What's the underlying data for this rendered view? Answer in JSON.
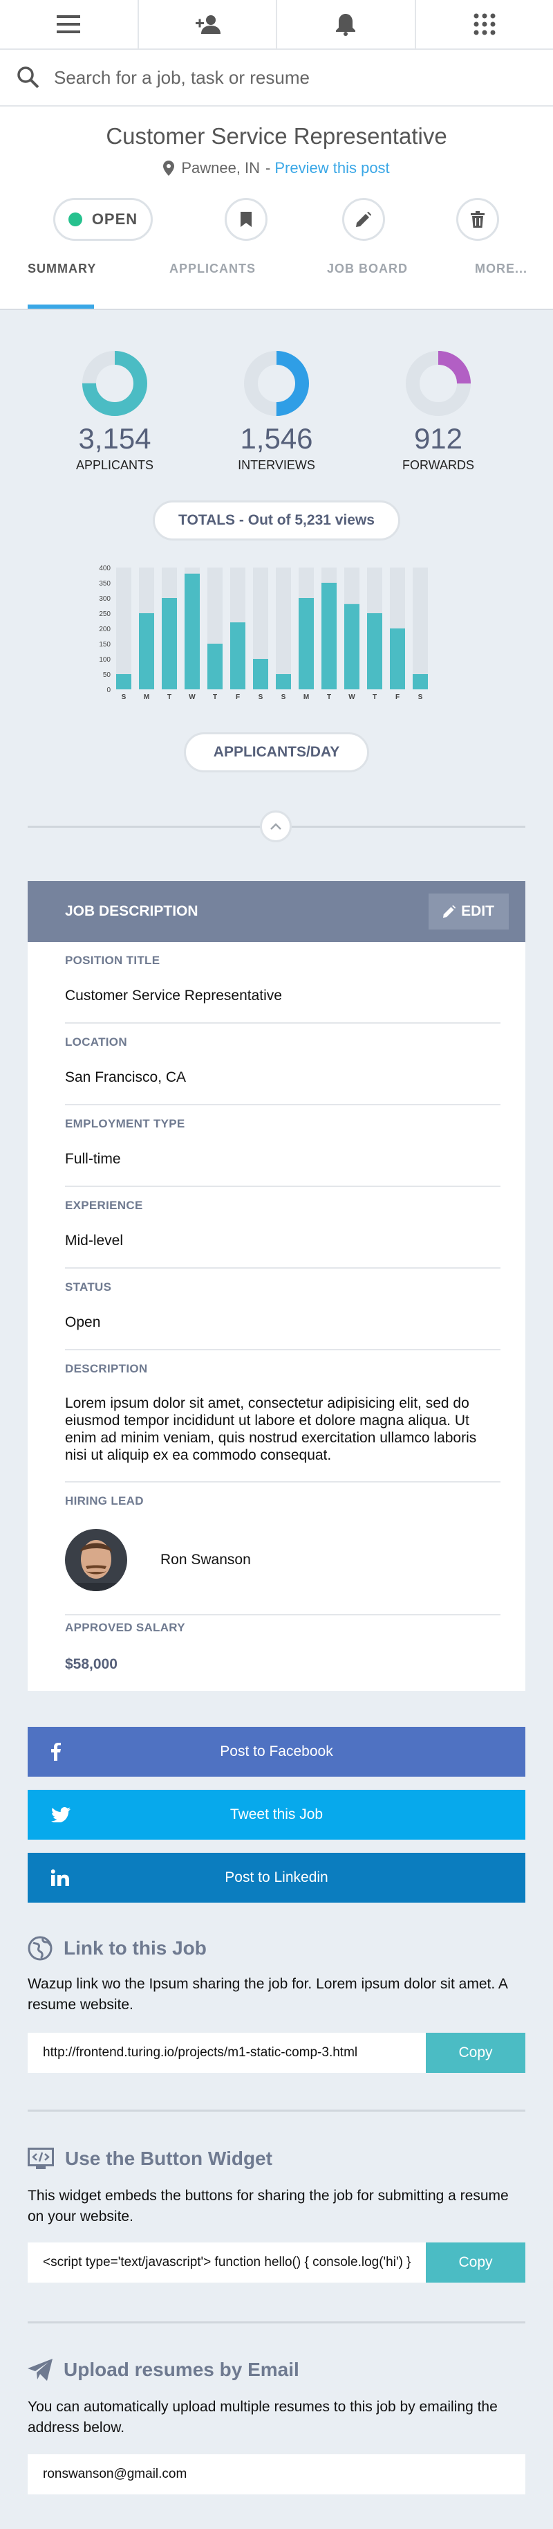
{
  "nav": {
    "icons": [
      "menu-icon",
      "add-user-icon",
      "bell-icon",
      "apps-grid-icon"
    ]
  },
  "search": {
    "placeholder": "Search for a job, task or resume"
  },
  "job": {
    "title": "Customer Service Representative",
    "location": "Pawnee, IN",
    "separator": "-",
    "preview_link": "Preview this post",
    "status_label": "OPEN",
    "status_color": "#26c18e"
  },
  "tabs": [
    "SUMMARY",
    "APPLICANTS",
    "JOB BOARD",
    "MORE..."
  ],
  "stats": [
    {
      "value": "3,154",
      "label": "APPLICANTS",
      "fraction": 0.75,
      "color": "#4bbcc4"
    },
    {
      "value": "1,546",
      "label": "INTERVIEWS",
      "fraction": 0.5,
      "color": "#2f9ee6"
    },
    {
      "value": "912",
      "label": "FORWARDS",
      "fraction": 0.25,
      "color": "#b25fc4"
    }
  ],
  "totals_label": "TOTALS - Out of 5,231 views",
  "applicants_day_label": "APPLICANTS/DAY",
  "chart_data": {
    "type": "bar",
    "categories": [
      "S",
      "M",
      "T",
      "W",
      "T",
      "F",
      "S",
      "S",
      "M",
      "T",
      "W",
      "T",
      "F",
      "S"
    ],
    "values": [
      50,
      250,
      300,
      380,
      150,
      220,
      100,
      50,
      300,
      350,
      280,
      250,
      200,
      50
    ],
    "max": 400,
    "yticks": [
      400,
      350,
      300,
      250,
      200,
      150,
      100,
      50,
      0
    ],
    "bar_color": "#4bbcc4",
    "track_color": "#dde3e9"
  },
  "job_description": {
    "header": "JOB DESCRIPTION",
    "edit_label": "EDIT",
    "fields": [
      {
        "label": "POSITION TITLE",
        "value": "Customer Service Representative"
      },
      {
        "label": "LOCATION",
        "value": "San Francisco, CA"
      },
      {
        "label": "EMPLOYMENT TYPE",
        "value": "Full-time"
      },
      {
        "label": "EXPERIENCE",
        "value": "Mid-level"
      },
      {
        "label": "STATUS",
        "value": "Open"
      },
      {
        "label": "DESCRIPTION",
        "value": "Lorem ipsum dolor sit amet, consectetur adipisicing elit, sed do eiusmod tempor incididunt ut labore et dolore magna aliqua. Ut enim ad minim veniam, quis nostrud exercitation ullamco laboris nisi ut aliquip ex ea commodo consequat."
      }
    ],
    "hiring_lead_label": "HIRING LEAD",
    "hiring_lead_name": "Ron Swanson",
    "salary_label": "APPROVED SALARY",
    "salary_value": "$58,000"
  },
  "social": [
    {
      "label": "Post to Facebook",
      "color": "#4f72c2",
      "icon": "facebook-icon"
    },
    {
      "label": "Tweet this Job",
      "color": "#07a9ec",
      "icon": "twitter-icon"
    },
    {
      "label": "Post to Linkedin",
      "color": "#0b7dbf",
      "icon": "linkedin-icon"
    }
  ],
  "link_section": {
    "title": "Link to this Job",
    "text": "Wazup link wo the Ipsum sharing the job for. Lorem ipsum dolor sit amet. A resume website.",
    "url": "http://frontend.turing.io/projects/m1-static-comp-3.html",
    "copy_label": "Copy"
  },
  "widget_section": {
    "title": "Use the Button Widget",
    "text": "This widget embeds the buttons for sharing the job for submitting a resume on your website.",
    "code": "<script type='text/javascript'> function hello() { console.log('hi') }",
    "copy_label": "Copy"
  },
  "email_section": {
    "title": "Upload resumes by Email",
    "text": "You can automatically upload multiple resumes to this job by emailing the address below.",
    "email": "ronswanson@gmail.com"
  }
}
